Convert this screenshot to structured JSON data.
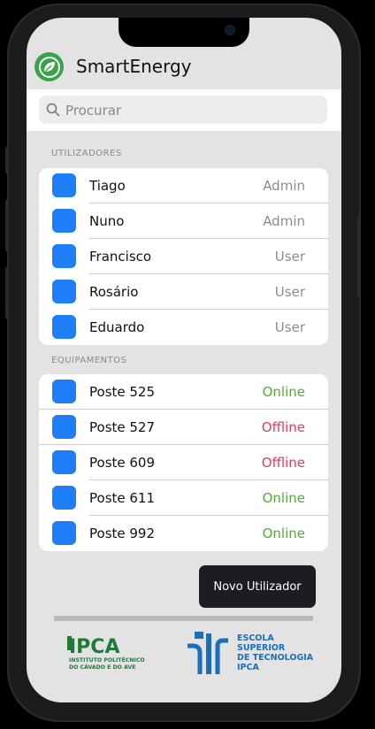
{
  "app": {
    "title": "SmartEnergy"
  },
  "search": {
    "placeholder": "Procurar"
  },
  "users": {
    "section_title": "UTILIZADORES",
    "items": [
      {
        "name": "Tiago",
        "role": "Admin"
      },
      {
        "name": "Nuno",
        "role": "Admin"
      },
      {
        "name": "Francisco",
        "role": "User"
      },
      {
        "name": "Rosário",
        "role": "User"
      },
      {
        "name": "Eduardo",
        "role": "User"
      }
    ]
  },
  "equipment": {
    "section_title": "EQUIPAMENTOS",
    "items": [
      {
        "name": "Poste 525",
        "status": "Online"
      },
      {
        "name": "Poste 527",
        "status": "Offline"
      },
      {
        "name": "Poste 609",
        "status": "Offline"
      },
      {
        "name": "Poste 611",
        "status": "Online"
      },
      {
        "name": "Poste 992",
        "status": "Online"
      }
    ]
  },
  "actions": {
    "new_user_label": "Novo Utilizador"
  },
  "footer": {
    "ipca_logo_text": "IPCA",
    "ipca_subtitle_1": "INSTITUTO POLITÉCNICO",
    "ipca_subtitle_2": "DO CÁVADO E DO AVE",
    "est_line_1": "ESCOLA",
    "est_line_2": "SUPERIOR",
    "est_line_3": "DE TECNOLOGIA",
    "est_line_4": "IPCA"
  },
  "colors": {
    "accent": "#1e7ef5",
    "online": "#55a83a",
    "offline": "#e6375c",
    "logo_green": "#3aa24a"
  }
}
